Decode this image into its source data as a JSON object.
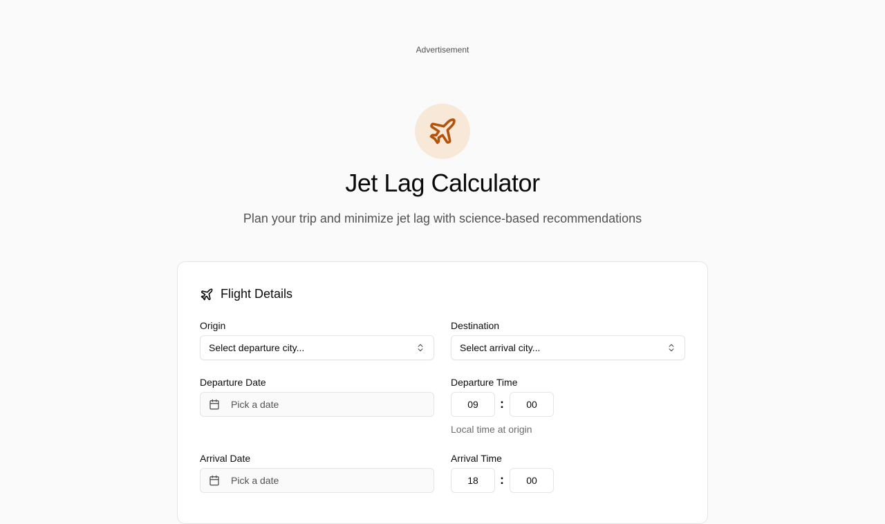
{
  "advertisement_label": "Advertisement",
  "hero": {
    "icon": "plane-icon",
    "title": "Jet Lag Calculator",
    "subtitle": "Plan your trip and minimize jet lag with science-based recommendations"
  },
  "card": {
    "title": "Flight Details",
    "icon": "plane-icon",
    "origin": {
      "label": "Origin",
      "placeholder": "Select departure city..."
    },
    "destination": {
      "label": "Destination",
      "placeholder": "Select arrival city..."
    },
    "departure_date": {
      "label": "Departure Date",
      "placeholder": "Pick a date"
    },
    "departure_time": {
      "label": "Departure Time",
      "hour": "09",
      "minute": "00",
      "separator": ":",
      "hint": "Local time at origin"
    },
    "arrival_date": {
      "label": "Arrival Date",
      "placeholder": "Pick a date"
    },
    "arrival_time": {
      "label": "Arrival Time",
      "hour": "18",
      "minute": "00",
      "separator": ":"
    }
  },
  "colors": {
    "accent": "#b45309",
    "accent_bg": "#f7e8d8",
    "page_bg": "#fafafa"
  }
}
